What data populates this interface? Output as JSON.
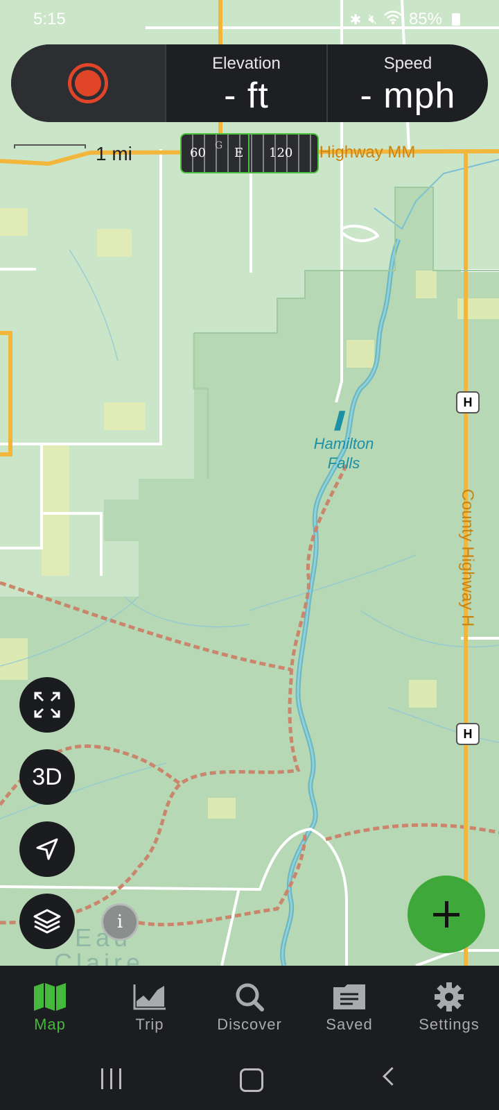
{
  "status_bar": {
    "time": "5:15",
    "battery_percent": "85%",
    "icons": [
      "bluetooth-icon",
      "mute-icon",
      "wifi-icon"
    ]
  },
  "top_panel": {
    "record_button": "record-icon",
    "elevation": {
      "label": "Elevation",
      "value": "- ft"
    },
    "speed": {
      "label": "Speed",
      "value": "- mph"
    }
  },
  "map": {
    "scale_label": "1 mi",
    "compass": {
      "left": "60",
      "center": "E",
      "right": "120",
      "marker": "G"
    },
    "labels": {
      "road_top": "County Highway MM",
      "road_right": "County Highway H",
      "waterfall_line1": "Hamilton",
      "waterfall_line2": "Falls",
      "place_line1": "Eau",
      "place_line2": "Claire",
      "highway_shield": "H"
    },
    "buttons": {
      "three_d": "3D",
      "info": "i"
    },
    "colors": {
      "road": "#f2b73a",
      "water": "#3aa0b8",
      "forest": "#b4d8b2",
      "trail": "#c8836a",
      "accent": "#3fa83a"
    }
  },
  "bottom_nav": {
    "items": [
      {
        "label": "Map",
        "icon": "map-icon",
        "active": true
      },
      {
        "label": "Trip",
        "icon": "trip-chart-icon",
        "active": false
      },
      {
        "label": "Discover",
        "icon": "search-icon",
        "active": false
      },
      {
        "label": "Saved",
        "icon": "saved-folder-icon",
        "active": false
      },
      {
        "label": "Settings",
        "icon": "gear-icon",
        "active": false
      }
    ]
  }
}
